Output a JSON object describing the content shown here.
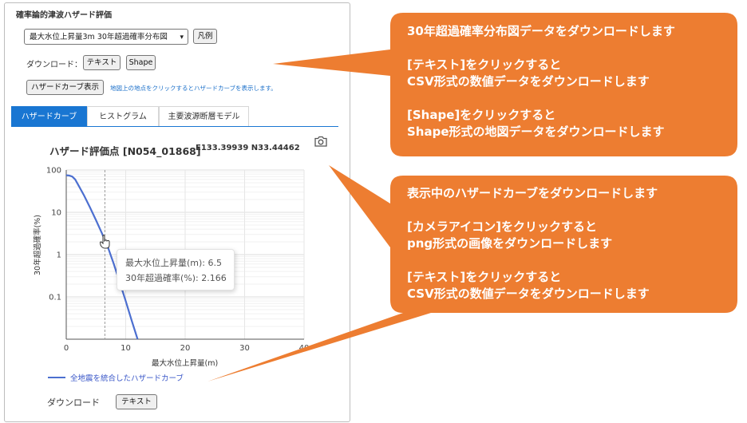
{
  "panel": {
    "title": "確率論的津波ハザード評価",
    "select_value": "最大水位上昇量3m 30年超過確率分布図",
    "legend_button": "凡例",
    "download_label": "ダウンロード：",
    "text_button": "テキスト",
    "shape_button": "Shape",
    "hazard_curve_button": "ハザードカーブ表示",
    "hint": "地図上の地点をクリックするとハザードカーブを表示します。"
  },
  "tabs": [
    {
      "label": "ハザードカーブ",
      "active": true
    },
    {
      "label": "ヒストグラム",
      "active": false
    },
    {
      "label": "主要波源断層モデル",
      "active": false
    }
  ],
  "chart_panel": {
    "title": "ハザード評価点 [N054_01868]",
    "coords": "E133.39939 N33.44462",
    "camera_icon": "camera-icon",
    "tooltip": {
      "line1": "最大水位上昇量(m): 6.5",
      "line2": "30年超過確率(%): 2.166"
    },
    "legend": "全地震を統合したハザードカーブ",
    "download_label": "ダウンロード",
    "text_button": "テキスト",
    "line_color": "#4c6fd0"
  },
  "chart_data": {
    "type": "line",
    "xlabel": "最大水位上昇量(m)",
    "ylabel": "30年超過確率(%)",
    "xlim": [
      0,
      40
    ],
    "ylim": [
      0.01,
      100
    ],
    "y_scale": "log",
    "x_ticks": [
      "0",
      "10",
      "20",
      "30",
      "40"
    ],
    "y_ticks": [
      "100",
      "10",
      "1",
      "0.1"
    ],
    "grid": true,
    "series": [
      {
        "name": "全地震を統合したハザードカーブ",
        "x": [
          0,
          0.5,
          1,
          1.5,
          2,
          3,
          4,
          5,
          6,
          6.5,
          7,
          8,
          9,
          10,
          11,
          12
        ],
        "y": [
          75,
          74,
          70,
          60,
          45,
          25,
          13,
          6.5,
          3.2,
          2.166,
          1.5,
          0.6,
          0.22,
          0.08,
          0.028,
          0.01
        ]
      }
    ],
    "cursor_x": 6.5
  },
  "callouts": [
    {
      "lines": [
        "30年超過確率分布図データをダウンロードします",
        "",
        "[テキスト]をクリックすると",
        "CSV形式の数値データをダウンロードします",
        "",
        "[Shape]をクリックすると",
        "Shape形式の地図データをダウンロードします"
      ],
      "color": "#ed7d31"
    },
    {
      "lines": [
        "表示中のハザードカーブをダウンロードします",
        "",
        "[カメラアイコン]をクリックすると",
        "png形式の画像をダウンロードします",
        "",
        "[テキスト]をクリックすると",
        "CSV形式の数値データをダウンロードします"
      ],
      "color": "#ed7d31"
    }
  ]
}
